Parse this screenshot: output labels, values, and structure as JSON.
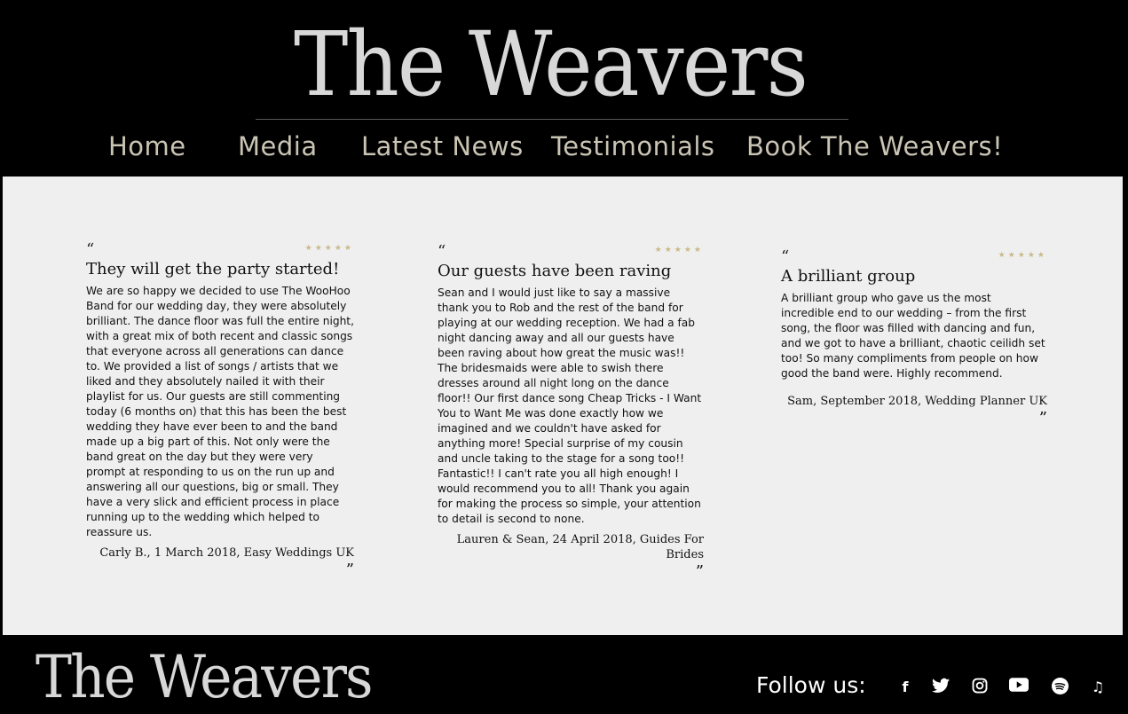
{
  "site": {
    "logo_text": "The Weavers",
    "footer_logo_text": "The Weavers"
  },
  "nav": {
    "items": [
      {
        "label": "Home"
      },
      {
        "label": "Media"
      },
      {
        "label": "Latest News"
      },
      {
        "label": "Testimonials"
      },
      {
        "label": "Book The Weavers!"
      }
    ]
  },
  "testimonials": [
    {
      "open_quote": "“",
      "stars": "★★★★★",
      "rating": 5,
      "title": "They will get the party started!",
      "body": "We are so happy we decided to use The WooHoo Band for our wedding day, they were absolutely brilliant. The dance floor was full the entire night, with a great mix of both recent and classic songs that everyone across all generations can dance to. We provided a list of songs / artists that we liked and they absolutely nailed it with their playlist for us. Our guests are still commenting today (6 months on) that this has been the best wedding they have ever been to and the band made up a big part of this. Not only were the band great on the day but they were very prompt at responding to us on the run up and answering all our questions, big or small. They have a very slick and efficient process in place running up to the wedding which helped to reassure us.",
      "author": "Carly B., 1 March 2018, Easy Weddings UK",
      "close_quote": "”"
    },
    {
      "open_quote": "“",
      "stars": "★★★★★",
      "rating": 5,
      "title": "Our guests have been raving",
      "body": "Sean and I would just like to say a massive thank you to Rob and the rest of the band for playing at our wedding reception. We had a fab night dancing away and all our guests have been raving about how great the music was!! The bridesmaids were able to swish there dresses around all night long on the dance floor!! Our first dance song Cheap Tricks - I Want You to Want Me was done exactly how we imagined and we couldn't have asked for anything more! Special surprise of my cousin and uncle taking to the stage for a song too!! Fantastic!! I can't rate you all high enough! I would recommend you to all! Thank you again for making the process so simple, your attention to detail is second to none.",
      "author": "Lauren & Sean, 24 April 2018, Guides For Brides",
      "close_quote": "”"
    },
    {
      "open_quote": "“",
      "stars": "★★★★★",
      "rating": 5,
      "title": "A brilliant group",
      "body": "A brilliant group who gave us the most incredible end to our wedding – from the first song, the floor was filled with dancing and fun, and we got to have a brilliant, chaotic ceilidh set too! So many compliments from people on how good the band were. Highly recommend.",
      "author": "Sam, September 2018, Wedding Planner UK",
      "close_quote": "”"
    }
  ],
  "footer": {
    "follow_label": "Follow us:",
    "social": [
      {
        "name": "facebook-icon",
        "glyph": "f"
      },
      {
        "name": "twitter-icon",
        "glyph": ""
      },
      {
        "name": "instagram-icon",
        "glyph": ""
      },
      {
        "name": "youtube-icon",
        "glyph": ""
      },
      {
        "name": "spotify-icon",
        "glyph": ""
      },
      {
        "name": "music-note-icon",
        "glyph": "♫"
      }
    ]
  },
  "colors": {
    "nav_text": "#c9c4b3",
    "star": "#c9b98a",
    "content_bg": "#efefef"
  }
}
